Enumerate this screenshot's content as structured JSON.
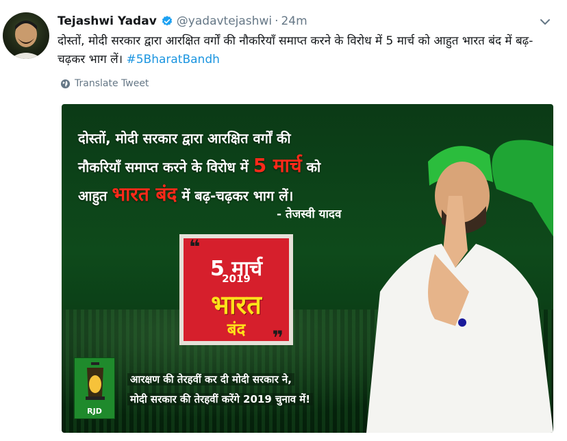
{
  "author": {
    "display_name": "Tejashwi Yadav",
    "handle": "@yadavtejashwi",
    "separator": "·",
    "timestamp": "24m",
    "verified_icon": "verified-badge-icon"
  },
  "tweet": {
    "text": "दोस्तों, मोदी सरकार द्वारा आरक्षित वर्गों की नौकरियाँ समाप्त करने के विरोध में 5 मार्च को आहुत भारत बंद में बढ़-चढ़कर भाग लें।",
    "hashtag": "#5BharatBandh",
    "translate_label": "Translate Tweet"
  },
  "poster": {
    "quote_line1": "दोस्तों, मोदी सरकार द्वारा आरक्षित वर्गों की",
    "quote_line2_prefix": "नौकरियाँ समाप्त करने के विरोध में",
    "quote_line2_highlight": "5 मार्च",
    "quote_line2_suffix": "को",
    "quote_line3_prefix": "आहुत",
    "quote_line3_highlight": "भारत बंद",
    "quote_line3_suffix": "में बढ़-चढ़कर भाग लें।",
    "author": "- तेजस्वी यादव",
    "date_text": "5 मार्च",
    "year_text": "2019",
    "bharat_text": "भारत",
    "band_text": "बंद",
    "logo_text": "RJD",
    "slogan_line1": "आरक्षण की तेरहवीं कर दी मोदी सरकार ने,",
    "slogan_line2": "मोदी सरकार की तेरहवीं करेंगे 2019 चुनाव में!"
  },
  "colors": {
    "link": "#1b95e0",
    "verified": "#1da1f2",
    "muted": "#657786",
    "poster_green": "#0e4a1b",
    "poster_red": "#d61f2c",
    "poster_yellow": "#ffe11a"
  }
}
